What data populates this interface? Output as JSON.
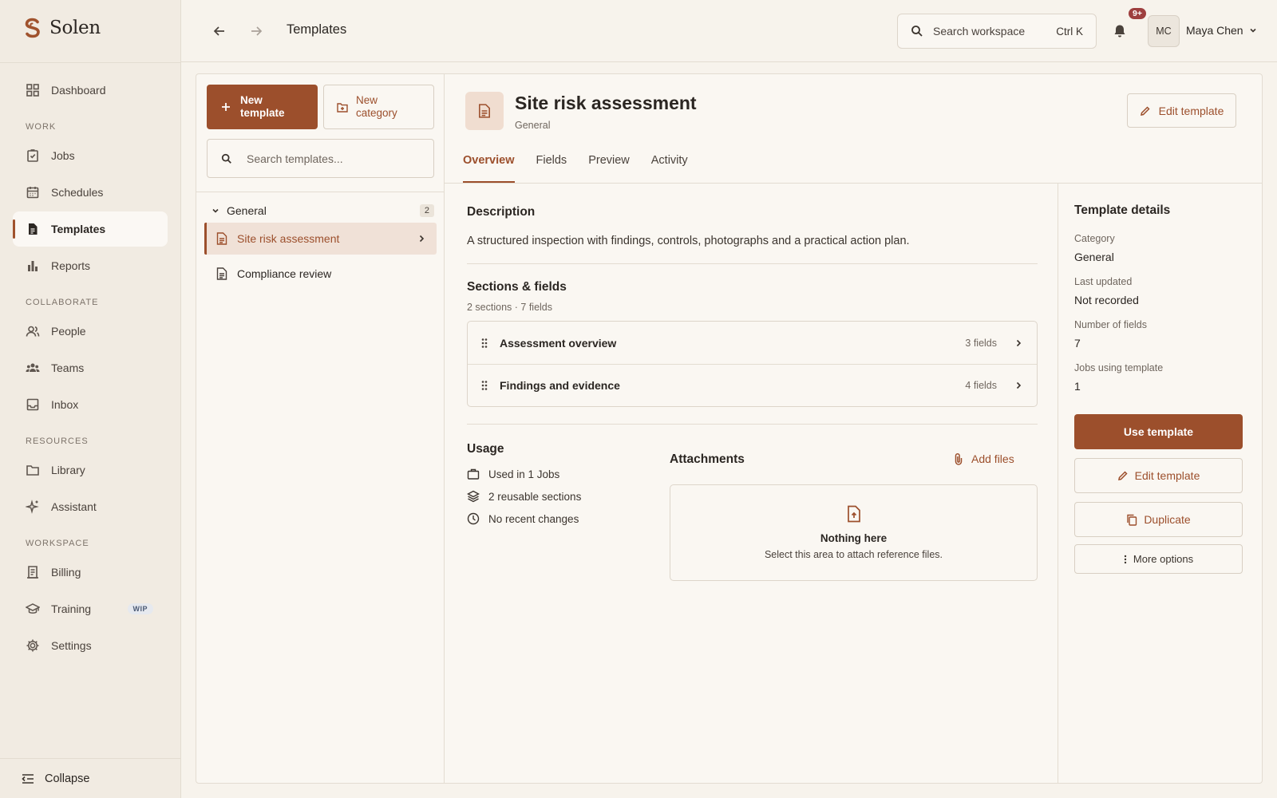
{
  "brand": {
    "name": "Solen",
    "accent": "#9c4f2c"
  },
  "sidebar": {
    "top_items": [
      {
        "label": "Dashboard",
        "icon": "grid-icon"
      }
    ],
    "sections": [
      {
        "title": "WORK",
        "items": [
          {
            "label": "Jobs",
            "icon": "clipboard-check-icon"
          },
          {
            "label": "Schedules",
            "icon": "calendar-icon"
          },
          {
            "label": "Templates",
            "icon": "document-icon",
            "active": true
          },
          {
            "label": "Reports",
            "icon": "bar-chart-icon"
          }
        ]
      },
      {
        "title": "COLLABORATE",
        "items": [
          {
            "label": "People",
            "icon": "people-icon"
          },
          {
            "label": "Teams",
            "icon": "teams-icon"
          },
          {
            "label": "Inbox",
            "icon": "inbox-icon"
          }
        ]
      },
      {
        "title": "RESOURCES",
        "items": [
          {
            "label": "Library",
            "icon": "folder-icon"
          },
          {
            "label": "Assistant",
            "icon": "sparkle-icon"
          }
        ]
      },
      {
        "title": "WORKSPACE",
        "items": [
          {
            "label": "Billing",
            "icon": "receipt-icon"
          },
          {
            "label": "Training",
            "icon": "graduation-icon",
            "badge": "WIP"
          },
          {
            "label": "Settings",
            "icon": "gear-icon"
          }
        ]
      }
    ],
    "collapse_label": "Collapse"
  },
  "topbar": {
    "title": "Templates",
    "search_placeholder": "Search workspace",
    "search_shortcut": "Ctrl K",
    "notification_count": "9+",
    "avatar_initials": "MC",
    "user_name": "Maya Chen"
  },
  "template_list": {
    "new_template_label": "New template",
    "new_category_label": "New category",
    "search_placeholder": "Search templates...",
    "group": {
      "name": "General",
      "count": "2"
    },
    "items": [
      {
        "name": "Site risk assessment",
        "active": true
      },
      {
        "name": "Compliance review"
      }
    ]
  },
  "detail": {
    "title": "Site risk assessment",
    "category": "General",
    "edit_label": "Edit template",
    "tabs": [
      "Overview",
      "Fields",
      "Preview",
      "Activity"
    ],
    "active_tab": "Overview",
    "description_heading": "Description",
    "description": "A structured inspection with findings, controls, photographs and a practical action plan.",
    "sections_heading": "Sections & fields",
    "sections_meta": "2 sections · 7 fields",
    "sections": [
      {
        "name": "Assessment overview",
        "count": "3 fields"
      },
      {
        "name": "Findings and evidence",
        "count": "4 fields"
      }
    ],
    "usage_heading": "Usage",
    "usage": [
      {
        "text": "Used in 1 Jobs",
        "icon": "briefcase-icon"
      },
      {
        "text": "2 reusable sections",
        "icon": "layers-icon"
      },
      {
        "text": "No recent changes",
        "icon": "clock-icon"
      }
    ],
    "attachments_heading": "Attachments",
    "add_files_label": "Add files",
    "empty_title": "Nothing here",
    "empty_text": "Select this area to attach reference files."
  },
  "details_panel": {
    "title": "Template details",
    "fields": [
      {
        "label": "Category",
        "value": "General"
      },
      {
        "label": "Last updated",
        "value": "Not recorded"
      },
      {
        "label": "Number of fields",
        "value": "7"
      },
      {
        "label": "Jobs using template",
        "value": "1"
      }
    ],
    "use_label": "Use template",
    "edit_label": "Edit template",
    "duplicate_label": "Duplicate",
    "more_label": "More options"
  }
}
